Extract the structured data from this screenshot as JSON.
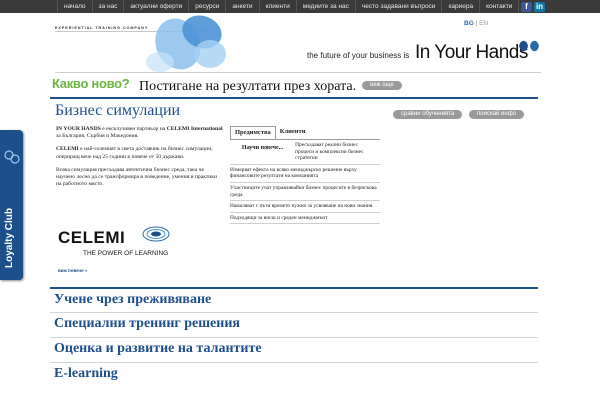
{
  "topnav": {
    "items": [
      "начало",
      "за нас",
      "актуални оферти",
      "ресурси",
      "анкети",
      "клиенти",
      "медиите за нас",
      "често задавани въпроси",
      "кариера",
      "контакти"
    ],
    "social": {
      "facebook": "f",
      "linkedin": "in"
    }
  },
  "header": {
    "company_tag": "EXPERIENTIAL TRAINING COMPANY",
    "lang_bg": "BG",
    "lang_sep": " | ",
    "lang_en": "EN",
    "slogan": "the future of your business is",
    "brand": "In Your Hands",
    "colors": {
      "brand_blue": "#1e4f8c",
      "butterfly": "#6fb0ea"
    }
  },
  "news": {
    "label": "Какво ново?",
    "text": "Постигане на резултати през хората.",
    "more": "виж още"
  },
  "loyalty": {
    "label": "Loyalty Club"
  },
  "section": {
    "title": "Бизнес симулации",
    "compare_btn": "сравни обученията",
    "offer_btn": "поискай инфо"
  },
  "intro": {
    "p1_bold": "IN YOUR HANDS",
    "p1_rest": " е ексклузивен партньор на ",
    "p1_bold2": "CELEMI International",
    "p1_end": " за България, Сърбия и Македония.",
    "p2_bold": "CELEMI",
    "p2_rest": " е най-големият в света доставчик на бизнес симулации, опериращ вече над 25 години в повече от 50 държави.",
    "p3": "Всяка симулация пресъздава автентична бизнес среда, така че научено лесно да се трансформира в поведение, умения и практики на работното място.",
    "logo_word": "CELEMI",
    "logo_sub": "THE POWER OF LEARNING",
    "see_more": "виж повече »"
  },
  "tabs": {
    "tab1": "Предимства",
    "tab2": "Клиенти",
    "first_left": "Научи повече...",
    "first_right": "Пресъздават реални бизнес процеси и комплексни бизнес стратегии",
    "rows": [
      "Измерват ефекта на всяко мениджърско решение върху финансовите резултати на компанията",
      "Участниците учат управлявайки бизнес процесите в безрискова среда",
      "Намаляват с пъти времето нужно за усвояване на нови знания",
      "Подходящи за висш и среден мениджмънт"
    ]
  },
  "bottom_links": [
    "Учене чрез преживяване",
    "Специални тренинг решения",
    "Оценка и развитие на талантите",
    "E-learning"
  ]
}
